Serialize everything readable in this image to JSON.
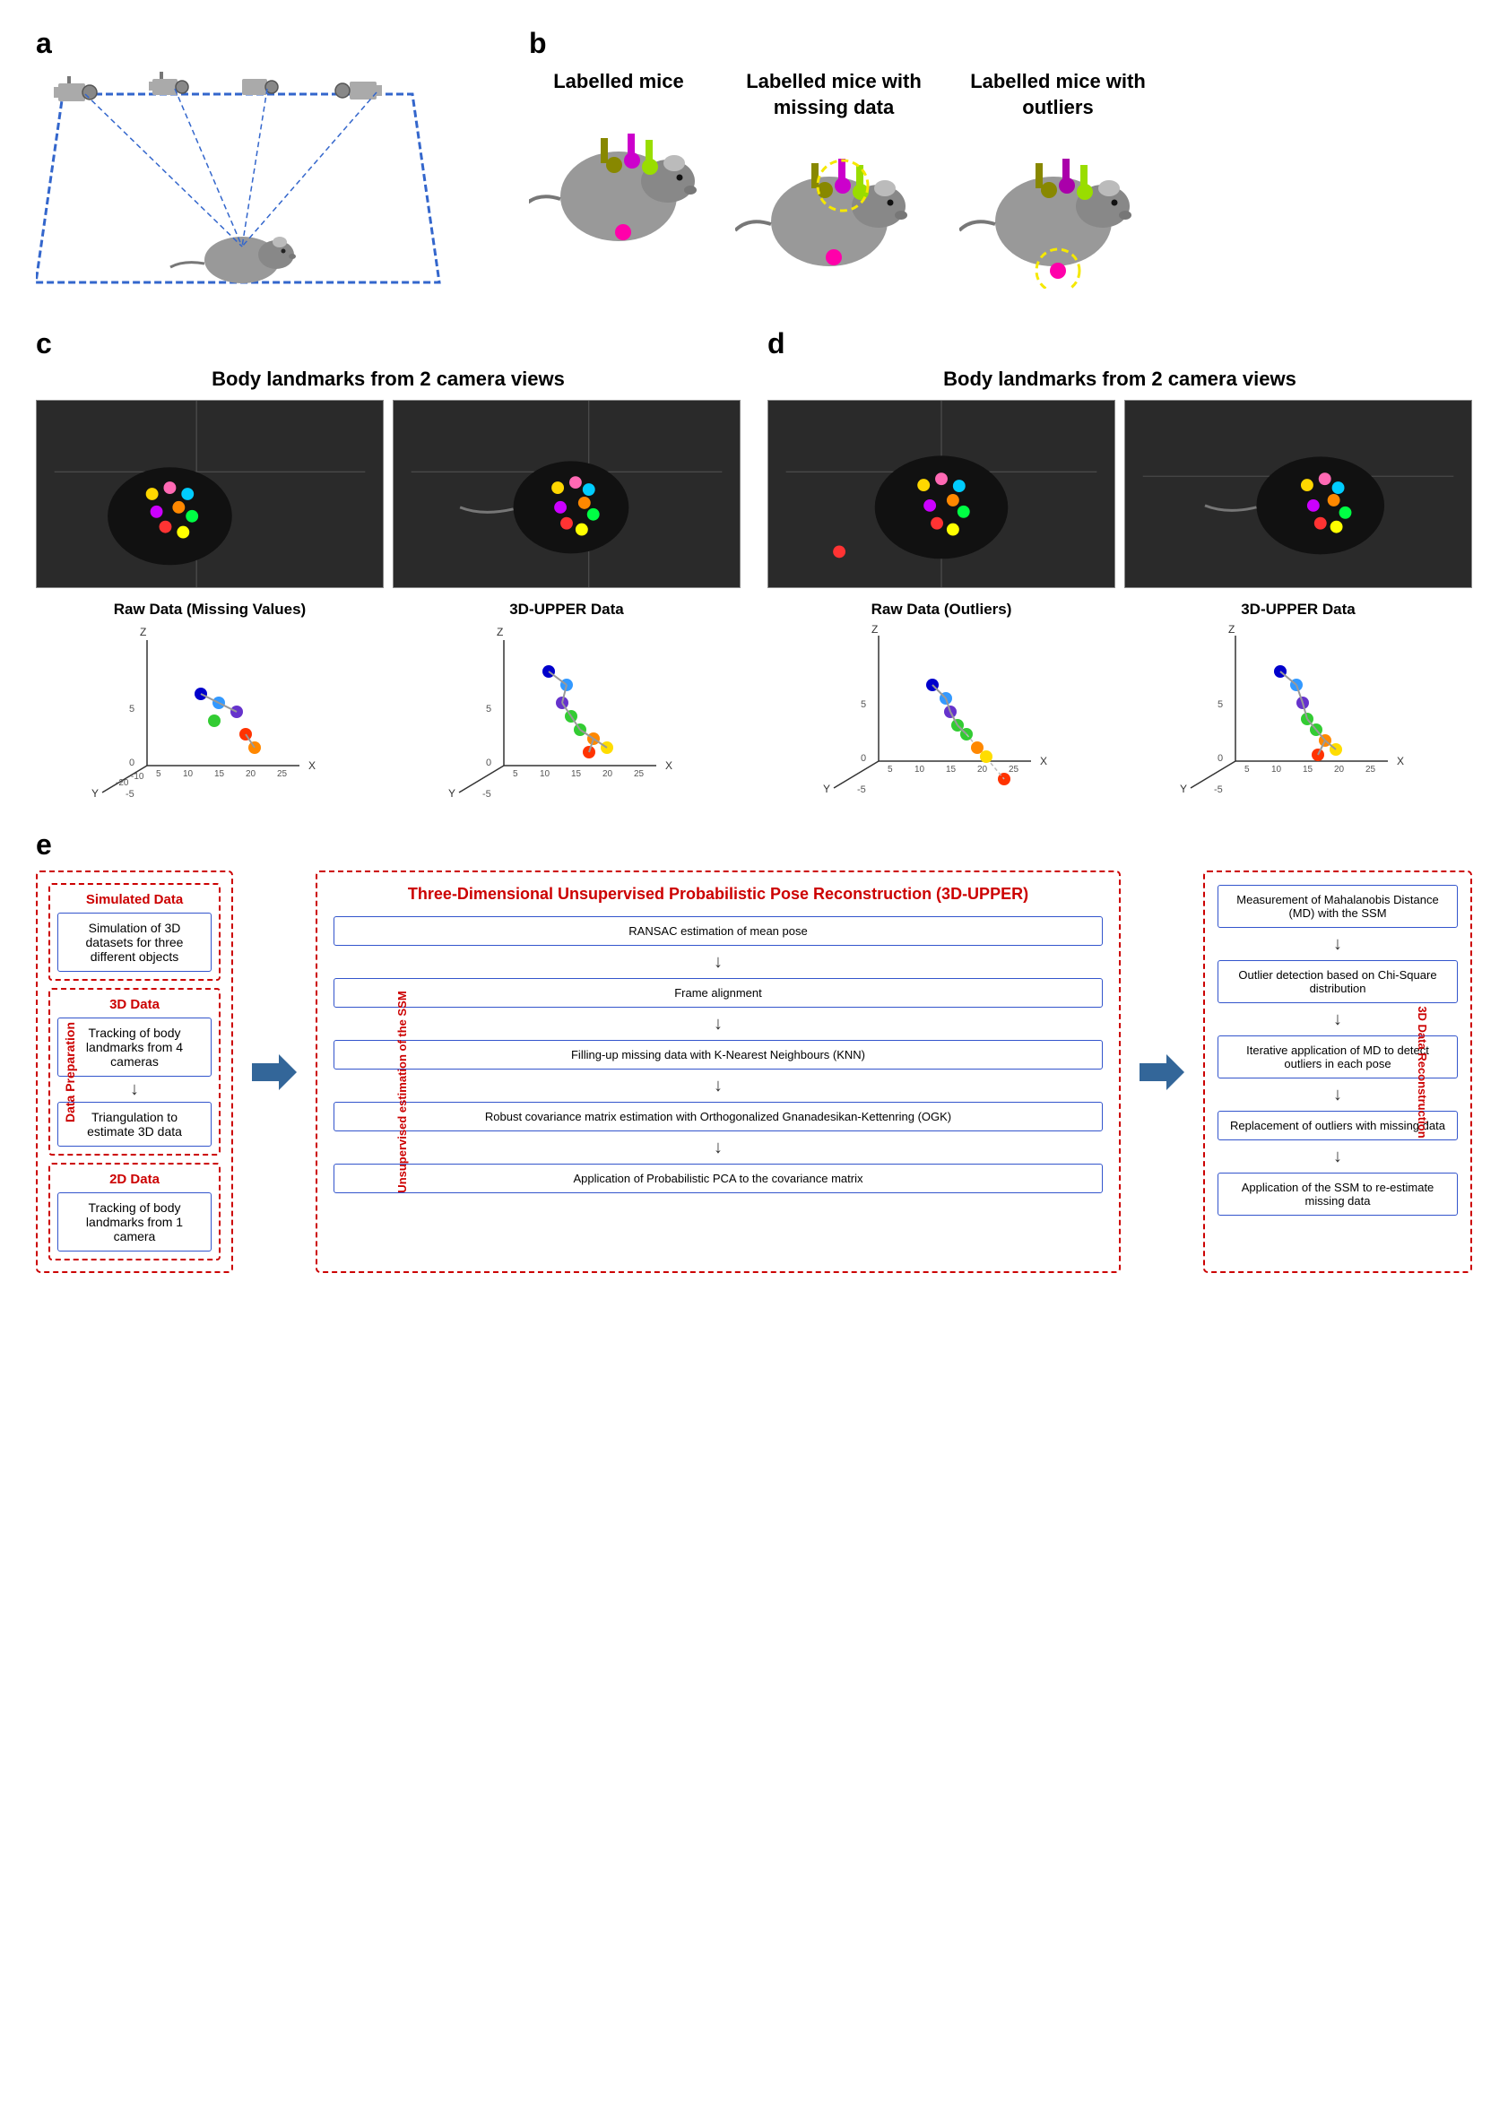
{
  "panels": {
    "a": {
      "label": "a"
    },
    "b": {
      "label": "b"
    },
    "c": {
      "label": "c"
    },
    "d": {
      "label": "d"
    },
    "e": {
      "label": "e"
    }
  },
  "section_b": {
    "mouse1": {
      "label": "Labelled mice"
    },
    "mouse2": {
      "label": "Labelled mice with\nmissing data"
    },
    "mouse3": {
      "label": "Labelled mice with\noutliers"
    }
  },
  "section_c": {
    "title": "Body landmarks from 2 camera views",
    "plot1_title": "Raw Data (Missing Values)",
    "plot2_title": "3D-UPPER Data"
  },
  "section_d": {
    "title": "Body landmarks from 2 camera views",
    "plot1_title": "Raw Data (Outliers)",
    "plot2_title": "3D-UPPER Data"
  },
  "section_e": {
    "label": "e",
    "data_prep": {
      "label": "Data Preparation",
      "simulated": {
        "title": "Simulated Data",
        "box1": "Simulation of 3D datasets for three different objects"
      },
      "data3d": {
        "title": "3D Data",
        "box1": "Tracking of body landmarks from 4 cameras",
        "box2": "Triangulation to estimate 3D data"
      },
      "data2d": {
        "title": "2D Data",
        "box1": "Tracking of body landmarks from 1 camera"
      }
    },
    "ssm": {
      "title": "Three-Dimensional Unsupervised Probabilistic Pose Reconstruction (3D-UPPER)",
      "vert_label": "Unsupervised estimation of the SSM",
      "steps": [
        "RANSAC estimation of mean pose",
        "Frame alignment",
        "Filling-up missing data with K-Nearest Neighbours (KNN)",
        "Robust covariance matrix estimation with Orthogonalized Gnanadesikan-Kettenring (OGK)",
        "Application of Probabilistic PCA to the covariance matrix"
      ]
    },
    "recon": {
      "vert_label": "3D Data Reconstruction",
      "steps": [
        "Measurement of Mahalanobis Distance (MD) with the SSM",
        "Outlier detection based on Chi-Square distribution",
        "Iterative application of MD to detect outliers in each pose",
        "Replacement of outliers with missing data",
        "Application of the SSM to re-estimate missing data"
      ]
    }
  }
}
